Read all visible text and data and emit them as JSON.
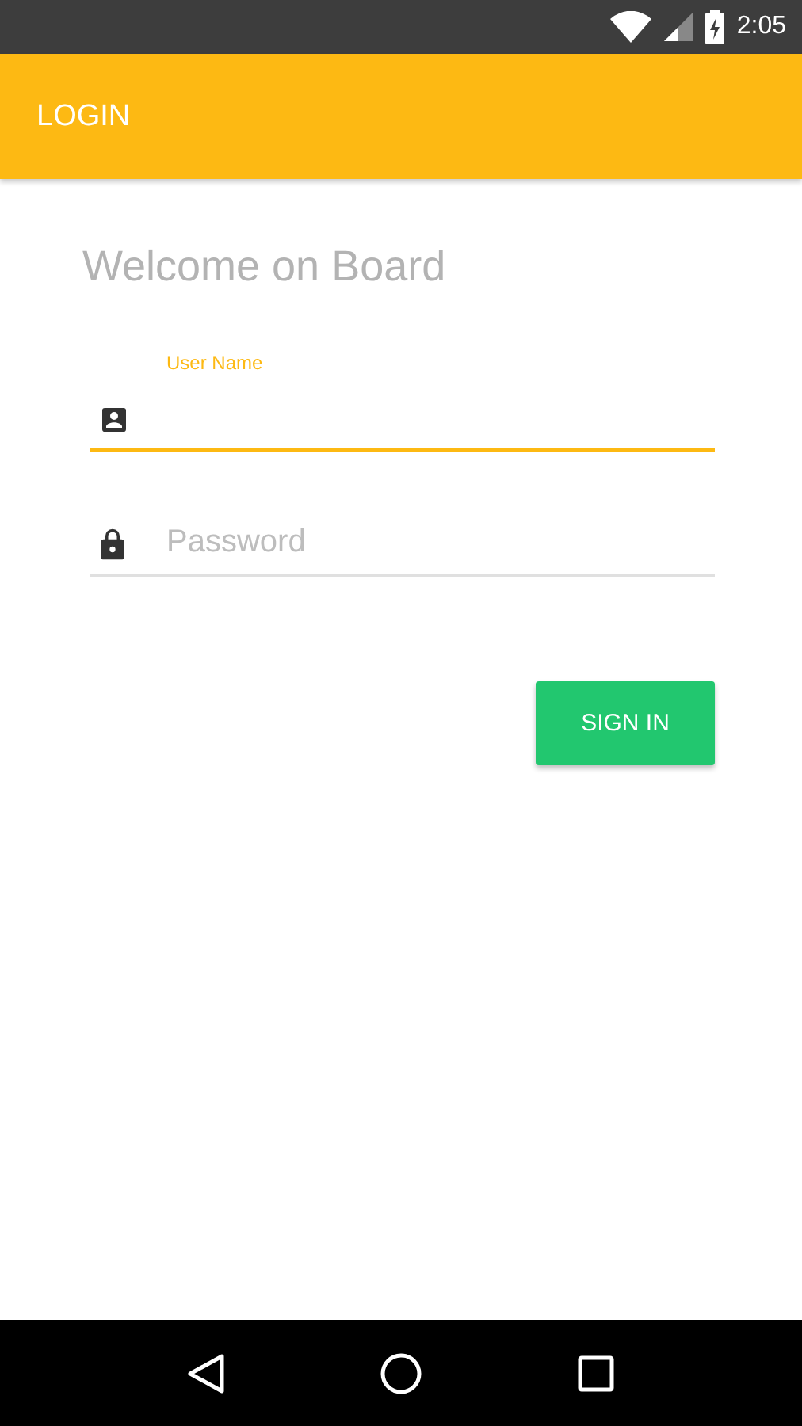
{
  "status_bar": {
    "time": "2:05"
  },
  "app_bar": {
    "title": "LOGIN"
  },
  "heading": "Welcome on Board",
  "fields": [
    {
      "kind": "user",
      "label": "User Name",
      "focused": true
    },
    {
      "kind": "password",
      "placeholder": "Password",
      "focused": false
    }
  ],
  "button": {
    "label": "SIGN IN"
  }
}
